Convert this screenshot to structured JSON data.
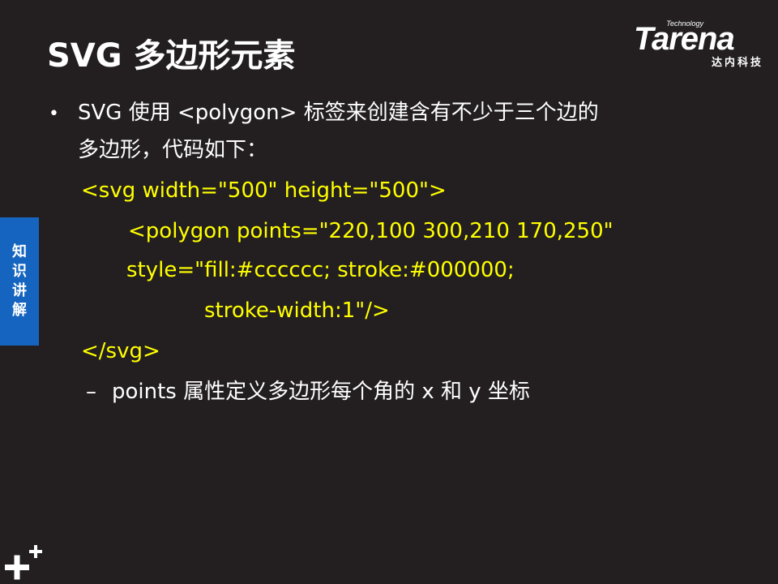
{
  "title": "SVG 多边形元素",
  "logo": {
    "small_text": "Technology",
    "word": "Tarena",
    "cn": "达内科技"
  },
  "side_tab": [
    "知",
    "识",
    "讲",
    "解"
  ],
  "bullet": {
    "line1": "SVG 使用 <polygon> 标签来创建含有不少于三个边的",
    "line2": "多边形，代码如下："
  },
  "code": [
    "<svg width=\"500\" height=\"500\">",
    "<polygon points=\"220,100 300,210 170,250\"",
    "style=\"fill:#cccccc; stroke:#000000;",
    "stroke-width:1\"/>",
    "</svg>"
  ],
  "sub_bullet": "points 属性定义多边形每个角的 x 和 y 坐标",
  "colors": {
    "background": "#231f20",
    "code": "#ffff00",
    "side_tab": "#1565c0"
  }
}
